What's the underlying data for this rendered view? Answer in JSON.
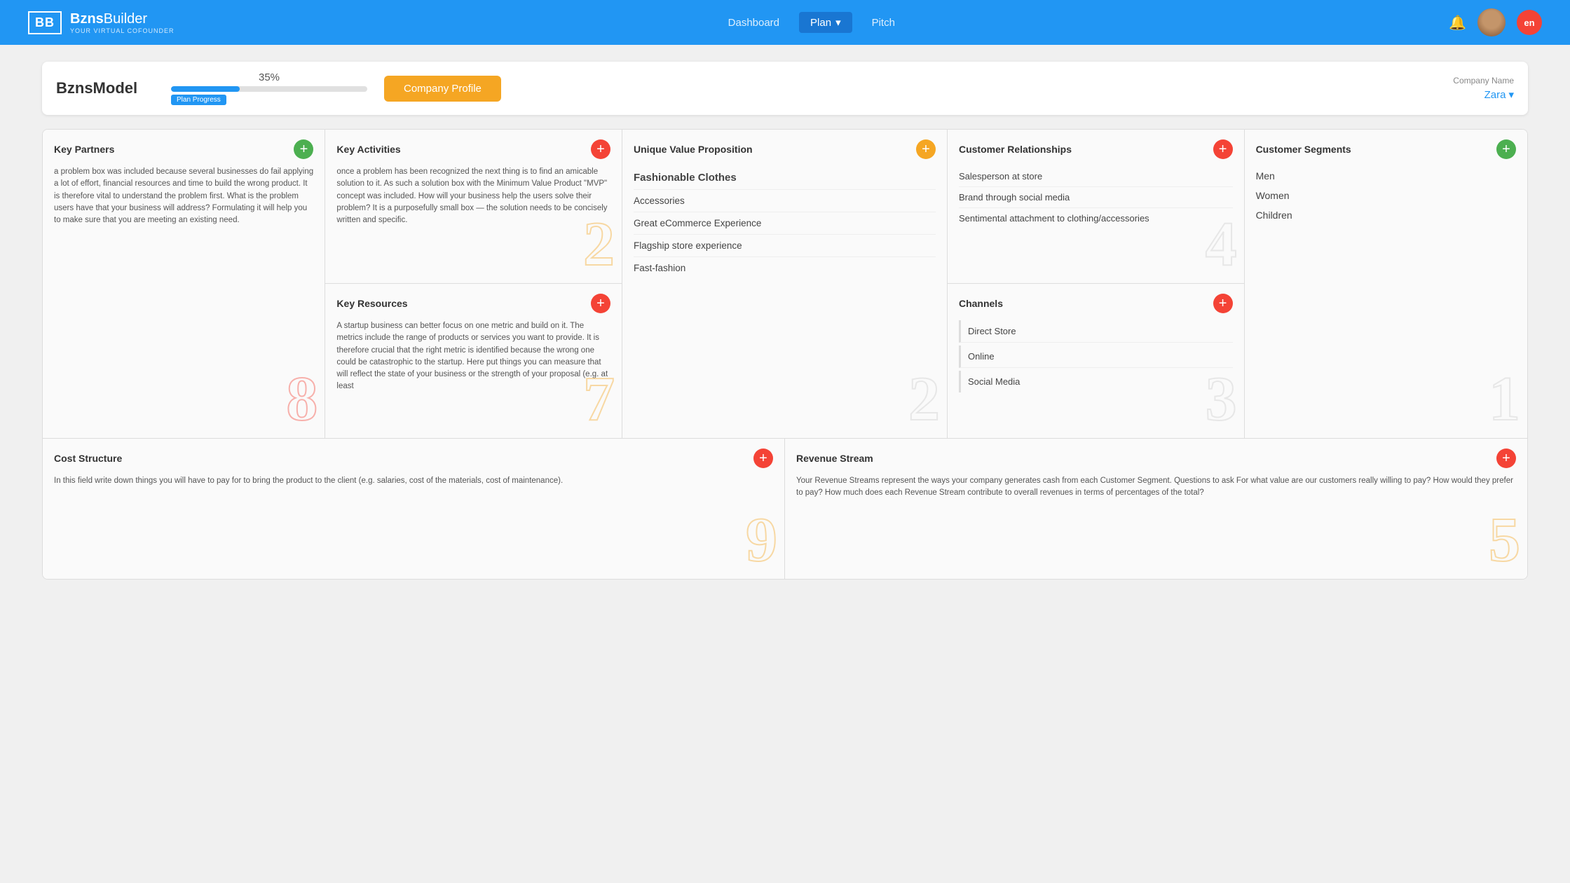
{
  "header": {
    "logo_initials": "BB",
    "logo_brand": "Bzns",
    "logo_brand2": "Builder",
    "logo_subtitle": "YOUR VIRTUAL COFOUNDER",
    "nav": {
      "dashboard": "Dashboard",
      "plan": "Plan",
      "plan_arrow": "▾",
      "pitch": "Pitch"
    },
    "lang": "en"
  },
  "topbar": {
    "page_title": "BznsModel",
    "progress_percent": "35%",
    "progress_value": 35,
    "progress_label": "Plan Progress",
    "company_profile_btn": "Company Profile",
    "company_name_label": "Company Name",
    "company_name": "Zara",
    "dropdown_arrow": "▾"
  },
  "canvas": {
    "key_partners": {
      "title": "Key Partners",
      "btn_color": "green",
      "text": "a problem box was included because several businesses do fail applying a lot of effort, financial resources and time to build the wrong product. It is therefore vital to understand the problem first. What is the problem users have that your business will address? Formulating it will help you to make sure that you are meeting an existing need.",
      "watermark": "8",
      "watermark_color": "red"
    },
    "key_activities": {
      "title": "Key Activities",
      "btn_color": "red",
      "text": "once a problem has been recognized the next thing is to find an amicable solution to it. As such a solution box with the Minimum Value Product \"MVP\" concept was included. How will your business help the users solve their problem? It is a purposefully small box — the solution needs to be concisely written and specific.",
      "watermark": "2",
      "watermark_color": "yellow"
    },
    "key_resources": {
      "title": "Key Resources",
      "btn_color": "red",
      "text": "A startup business can better focus on one metric and build on it. The metrics include the range of products or services you want to provide. It is therefore crucial that the right metric is identified because the wrong one could be catastrophic to the startup. Here put things you can measure that will reflect the state of your business or the strength of your proposal (e.g. at least",
      "watermark": "7",
      "watermark_color": "yellow"
    },
    "unique_value_proposition": {
      "title": "Unique Value Proposition",
      "btn_color": "yellow",
      "items": [
        "Fashionable Clothes",
        "Accessories",
        "Great eCommerce Experience",
        "Flagship store experience",
        "Fast-fashion"
      ],
      "watermark": "2",
      "watermark_color": "white"
    },
    "customer_relationships": {
      "title": "Customer Relationships",
      "btn_color": "red",
      "items": [
        "Salesperson at store",
        "Brand through social media",
        "Sentimental attachment to clothing/accessories"
      ],
      "watermark": "4",
      "watermark_color": "white"
    },
    "channels": {
      "title": "Channels",
      "btn_color": "red",
      "items": [
        "Direct Store",
        "Online",
        "Social Media"
      ],
      "watermark": "3",
      "watermark_color": "white"
    },
    "customer_segments": {
      "title": "Customer Segments",
      "btn_color": "green",
      "items": [
        "Men",
        "Women",
        "Children"
      ],
      "watermark": "1",
      "watermark_color": "white"
    },
    "cost_structure": {
      "title": "Cost Structure",
      "btn_color": "red",
      "text": "In this field write down things you will have to pay for to bring the product to the client (e.g. salaries, cost of the materials, cost of maintenance).",
      "watermark": "9",
      "watermark_color": "yellow"
    },
    "revenue_stream": {
      "title": "Revenue Stream",
      "btn_color": "red",
      "text": "Your Revenue Streams represent the ways your company generates cash from each Customer Segment. Questions to ask For what value are our customers really willing to pay? How would they prefer to pay? How much does each Revenue Stream contribute to overall revenues in terms of percentages of the total?",
      "watermark": "5",
      "watermark_color": "yellow"
    }
  }
}
